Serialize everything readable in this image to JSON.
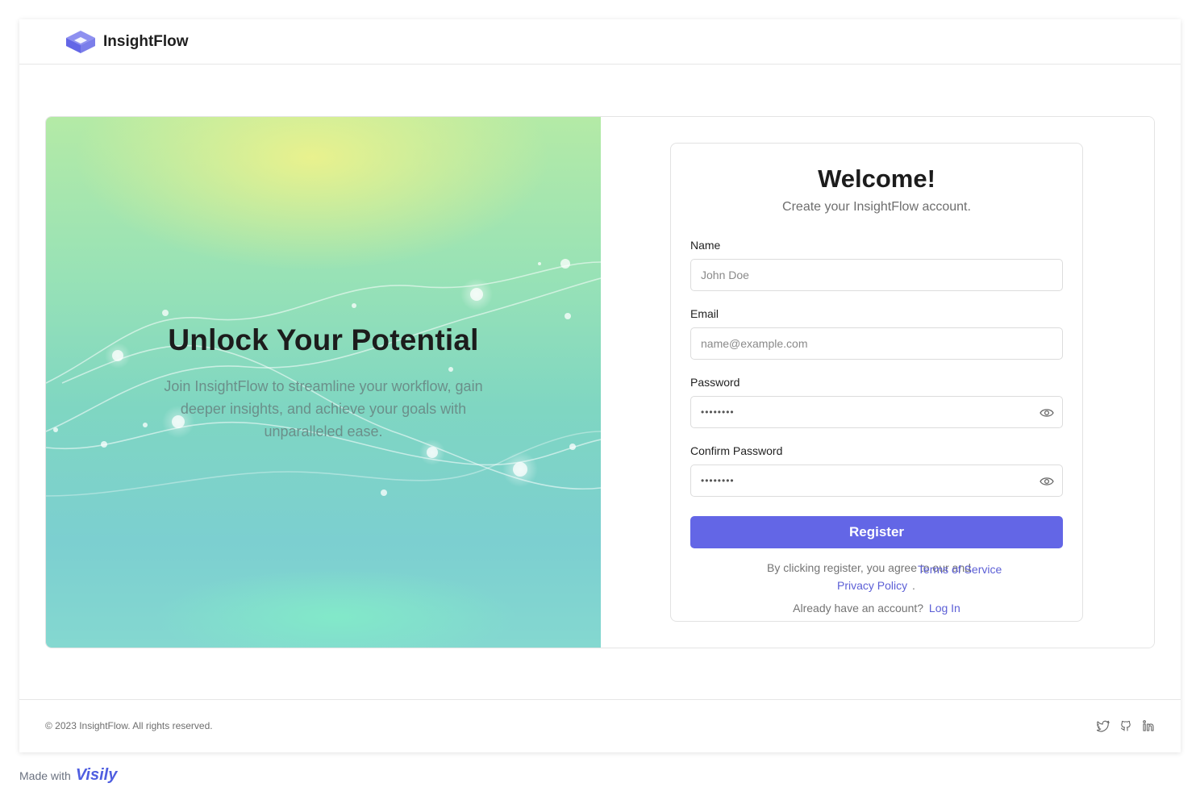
{
  "header": {
    "brand": "InsightFlow",
    "logo_icon": "cube-logo-icon"
  },
  "hero": {
    "title": "Unlock Your Potential",
    "subtitle": "Join InsightFlow to streamline your workflow, gain deeper insights, and achieve your goals with unparalleled ease."
  },
  "form": {
    "title": "Welcome!",
    "subtitle": "Create your InsightFlow account.",
    "name": {
      "label": "Name",
      "placeholder": "John Doe"
    },
    "email": {
      "label": "Email",
      "placeholder": "name@example.com"
    },
    "password": {
      "label": "Password",
      "masked": "••••••••",
      "icon": "eye-icon"
    },
    "confirm_password": {
      "label": "Confirm Password",
      "masked": "••••••••",
      "icon": "eye-icon"
    },
    "register_label": "Register",
    "terms_text": "By clicking register, you agree to our and",
    "terms_link": "Terms of Service",
    "privacy_link": "Privacy Policy",
    "terms_end": ".",
    "login_prompt": "Already have an account?",
    "login_link": "Log In"
  },
  "footer": {
    "copyright": "© 2023 InsightFlow. All rights reserved.",
    "socials": [
      "twitter-icon",
      "github-icon",
      "linkedin-icon"
    ]
  },
  "made_with": {
    "text": "Made with",
    "brand": "Visily"
  },
  "colors": {
    "accent": "#6366e6",
    "link": "#5c5fd6"
  }
}
